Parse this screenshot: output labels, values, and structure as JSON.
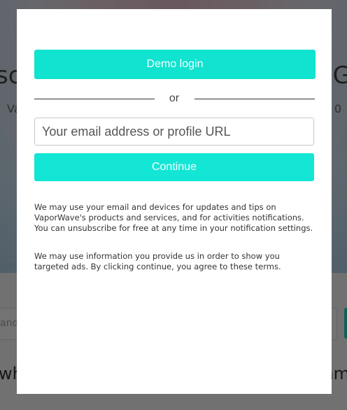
{
  "background": {
    "headline_left": "sc",
    "headline_right": "G",
    "sub_left": "Va",
    "sub_right": "0",
    "search_placeholder": "ands",
    "bottom_left": "wh",
    "bottom_right": "mm"
  },
  "modal": {
    "demo_login_label": "Demo login",
    "divider_text": "or",
    "email_placeholder": "Your email address or profile URL",
    "continue_label": "Continue",
    "notice_updates": "We may use your email and devices for updates and tips on VaporWave's products and services, and for activities notifications. You can unsubscribe for free at any time in your notification settings.",
    "notice_ads": "We may use information you provide us in order to show you targeted ads. By clicking continue, you agree to these terms."
  },
  "colors": {
    "accent": "#10e3cf",
    "overlay": "rgba(0,0,0,0.55)"
  }
}
